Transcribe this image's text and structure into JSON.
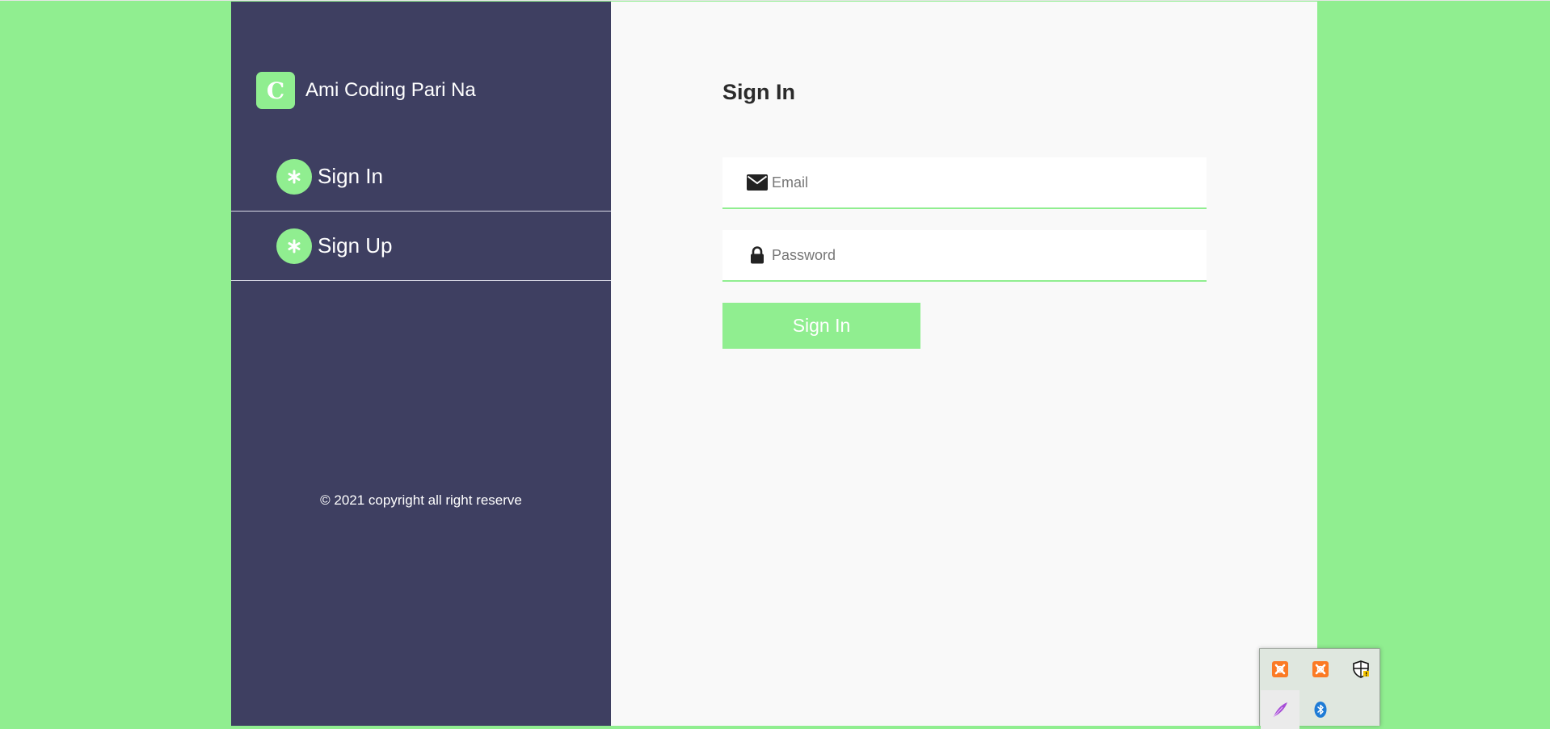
{
  "brand": {
    "logo_letter": "C",
    "name": "Ami Coding Pari Na"
  },
  "sidebar": {
    "items": [
      {
        "label": "Sign In",
        "icon": "asterisk-icon"
      },
      {
        "label": "Sign Up",
        "icon": "asterisk-icon"
      }
    ],
    "copyright": "© 2021 copyright all right reserve"
  },
  "form": {
    "title": "Sign In",
    "email_placeholder": "Email",
    "password_placeholder": "Password",
    "submit_label": "Sign In"
  },
  "system_tray": {
    "icons": [
      "xampp-icon",
      "xampp-icon",
      "windows-security-icon",
      "feather-icon",
      "bluetooth-icon"
    ]
  },
  "colors": {
    "accent": "#90ee90",
    "sidebar_bg": "#3e3f61",
    "main_bg": "#f9f9f9",
    "title_text": "#2b2b2b"
  }
}
